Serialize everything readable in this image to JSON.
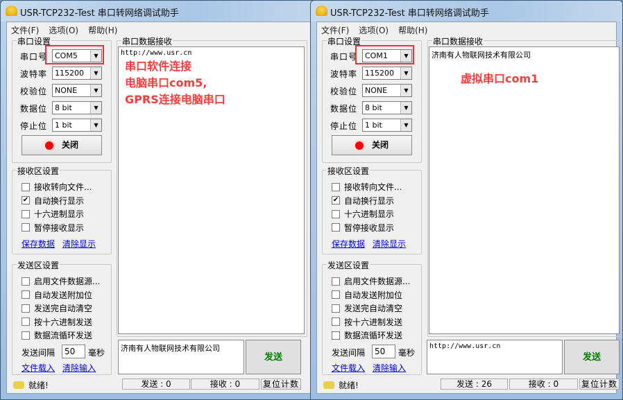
{
  "windows": [
    {
      "title": "USR-TCP232-Test 串口转网络调试助手",
      "menu": [
        "文件(F)",
        "选项(O)",
        "帮助(H)"
      ],
      "serial": {
        "group_title": "串口设置",
        "fields": [
          {
            "label": "串口号",
            "value": "COM5"
          },
          {
            "label": "波特率",
            "value": "115200"
          },
          {
            "label": "校验位",
            "value": "NONE"
          },
          {
            "label": "数据位",
            "value": "8 bit"
          },
          {
            "label": "停止位",
            "value": "1 bit"
          }
        ],
        "toggle_label": "关闭"
      },
      "receive_settings": {
        "group_title": "接收区设置",
        "options": [
          {
            "label": "接收转向文件...",
            "checked": false
          },
          {
            "label": "自动换行显示",
            "checked": true
          },
          {
            "label": "十六进制显示",
            "checked": false
          },
          {
            "label": "暂停接收显示",
            "checked": false
          }
        ],
        "links": [
          "保存数据",
          "清除显示"
        ]
      },
      "send_settings": {
        "group_title": "发送区设置",
        "options": [
          {
            "label": "启用文件数据源...",
            "checked": false
          },
          {
            "label": "自动发送附加位",
            "checked": false
          },
          {
            "label": "发送完自动清空",
            "checked": false
          },
          {
            "label": "按十六进制发送",
            "checked": false
          },
          {
            "label": "数据流循环发送",
            "checked": false
          }
        ],
        "interval_label": "发送间隔",
        "interval_value": "50",
        "interval_unit": "毫秒",
        "links": [
          "文件载入",
          "清除输入"
        ]
      },
      "receive_title": "串口数据接收",
      "received_text": "http://www.usr.cn",
      "send_text": "济南有人物联网技术有限公司",
      "send_button": "发送",
      "status": {
        "ready": "就绪!",
        "sent": "发送 : 0",
        "received": "接收 : 0",
        "reset": "复位计数"
      },
      "annotation": [
        "串口软件连接",
        "电脑串口com5,",
        "GPRS连接电脑串口"
      ]
    },
    {
      "title": "USR-TCP232-Test 串口转网络调试助手",
      "menu": [
        "文件(F)",
        "选项(O)",
        "帮助(H)"
      ],
      "serial": {
        "group_title": "串口设置",
        "fields": [
          {
            "label": "串口号",
            "value": "COM1"
          },
          {
            "label": "波特率",
            "value": "115200"
          },
          {
            "label": "校验位",
            "value": "NONE"
          },
          {
            "label": "数据位",
            "value": "8 bit"
          },
          {
            "label": "停止位",
            "value": "1 bit"
          }
        ],
        "toggle_label": "关闭"
      },
      "receive_settings": {
        "group_title": "接收区设置",
        "options": [
          {
            "label": "接收转向文件...",
            "checked": false
          },
          {
            "label": "自动换行显示",
            "checked": true
          },
          {
            "label": "十六进制显示",
            "checked": false
          },
          {
            "label": "暂停接收显示",
            "checked": false
          }
        ],
        "links": [
          "保存数据",
          "清除显示"
        ]
      },
      "send_settings": {
        "group_title": "发送区设置",
        "options": [
          {
            "label": "启用文件数据源...",
            "checked": false
          },
          {
            "label": "自动发送附加位",
            "checked": false
          },
          {
            "label": "发送完自动清空",
            "checked": false
          },
          {
            "label": "按十六进制发送",
            "checked": false
          },
          {
            "label": "数据流循环发送",
            "checked": false
          }
        ],
        "interval_label": "发送间隔",
        "interval_value": "50",
        "interval_unit": "毫秒",
        "links": [
          "文件载入",
          "清除输入"
        ]
      },
      "receive_title": "串口数据接收",
      "received_text": "济南有人物联网技术有限公司",
      "send_text": "http://www.usr.cn",
      "send_button": "发送",
      "status": {
        "ready": "就绪!",
        "sent": "发送 : 26",
        "received": "接收 : 0",
        "reset": "复位计数"
      },
      "annotation": [
        "虚拟串口com1"
      ]
    }
  ],
  "colors": {
    "annotation": "#ff3b3b",
    "send_button_text": "#008000",
    "link": "#0000ee"
  }
}
